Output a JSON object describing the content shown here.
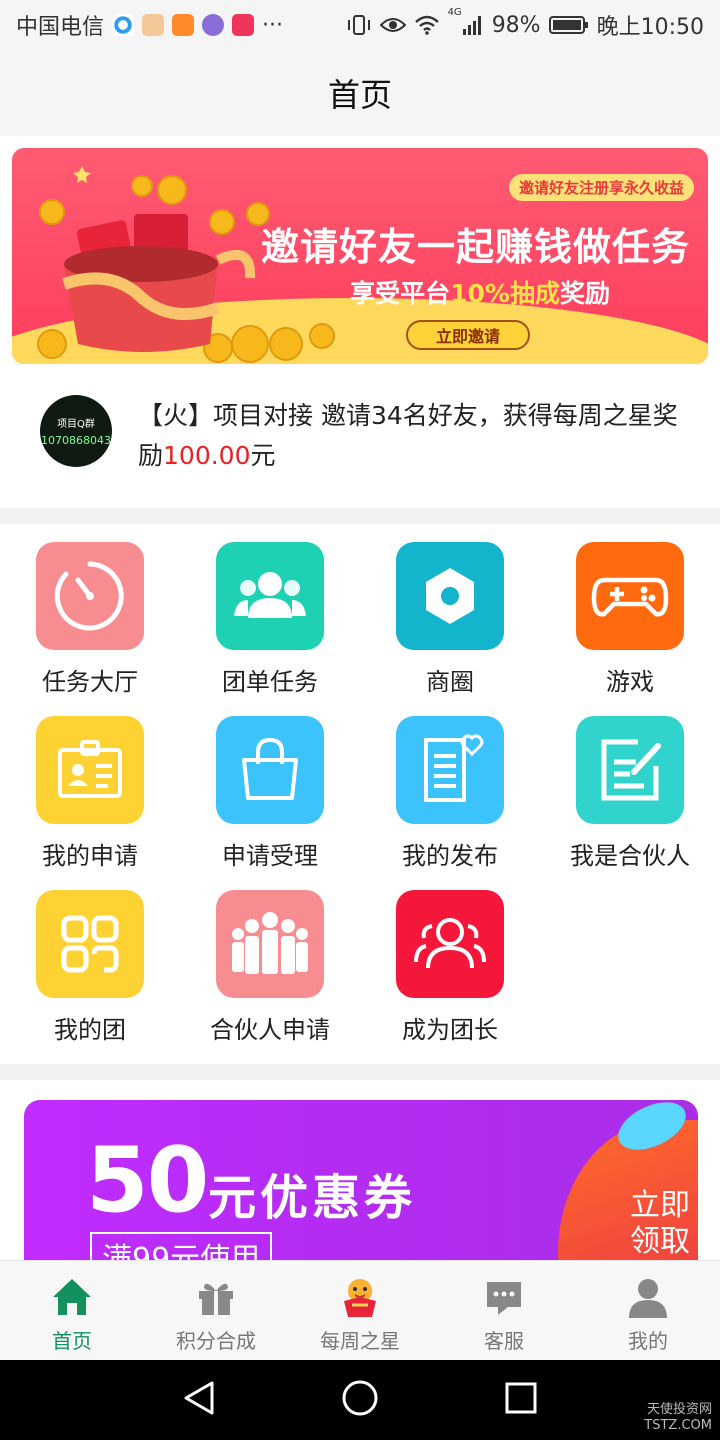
{
  "status_bar": {
    "carrier": "中国电信",
    "more": "···",
    "network": "4G",
    "battery": "98%",
    "time": "晚上10:50"
  },
  "nav": {
    "title": "首页"
  },
  "banner": {
    "tag": "邀请好友注册享永久收益",
    "headline": "邀请好友一起赚钱做任务",
    "sub_prefix": "享受平台",
    "sub_highlight": "10%抽成",
    "sub_suffix": "奖励",
    "button": "立即邀请"
  },
  "notice": {
    "avatar_line1": "项目Q群",
    "avatar_line2": "1070868043",
    "text_prefix": "【火】项目对接  邀请34名好友，获得每周之星奖励",
    "amount": "100.00",
    "text_suffix": "元"
  },
  "grid": {
    "items": [
      {
        "label": "任务大厅",
        "icon": "timer-icon",
        "color": "#f88d91"
      },
      {
        "label": "团单任务",
        "icon": "group-icon",
        "color": "#1ed1b2"
      },
      {
        "label": "商圈",
        "icon": "hexagon-icon",
        "color": "#12b5cc"
      },
      {
        "label": "游戏",
        "icon": "gamepad-icon",
        "color": "#ff6a0e"
      },
      {
        "label": "我的申请",
        "icon": "id-card-icon",
        "color": "#fed233"
      },
      {
        "label": "申请受理",
        "icon": "bag-icon",
        "color": "#3cc3fb"
      },
      {
        "label": "我的发布",
        "icon": "document-heart-icon",
        "color": "#3cc3fb"
      },
      {
        "label": "我是合伙人",
        "icon": "edit-note-icon",
        "color": "#30d4cc"
      },
      {
        "label": "我的团",
        "icon": "grid-apps-icon",
        "color": "#fed233"
      },
      {
        "label": "合伙人申请",
        "icon": "team-icon",
        "color": "#f88d91"
      },
      {
        "label": "成为团长",
        "icon": "users-icon",
        "color": "#f5173a"
      }
    ]
  },
  "coupon": {
    "amount": "50",
    "unit": "元优惠券",
    "condition": "满99元使用",
    "cta_line1": "立即",
    "cta_line2": "领取"
  },
  "tabbar": {
    "items": [
      {
        "label": "首页",
        "icon": "home-icon",
        "active": true
      },
      {
        "label": "积分合成",
        "icon": "gift-icon",
        "active": false
      },
      {
        "label": "每周之星",
        "icon": "star-mascot-icon",
        "active": false
      },
      {
        "label": "客服",
        "icon": "chat-icon",
        "active": false
      },
      {
        "label": "我的",
        "icon": "user-icon",
        "active": false
      }
    ]
  },
  "watermark": {
    "line1": "天使投资网",
    "line2": "TSTZ.COM"
  },
  "colors": {
    "accent": "#12915f",
    "money": "#e62222"
  }
}
